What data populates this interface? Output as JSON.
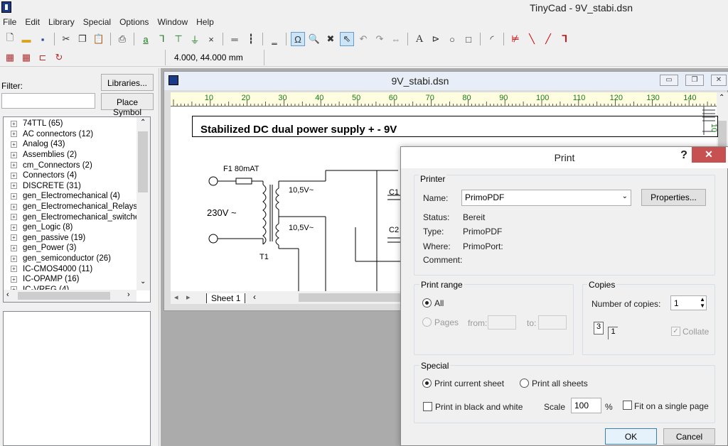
{
  "app": {
    "title": "TinyCad - 9V_stabi.dsn"
  },
  "menu": [
    "File",
    "Edit",
    "Library",
    "Special",
    "Options",
    "Window",
    "Help"
  ],
  "toolbar": {
    "coords": "4.000,  44.000 mm",
    "text_tool": "A",
    "omega_tool": "Ω",
    "close_x": "×"
  },
  "left_panel": {
    "filter_label": "Filter:",
    "filter_value": "",
    "libraries_button": "Libraries...",
    "place_symbol_button": "Place Symbol",
    "libraries": [
      "74TTL (65)",
      "AC connectors (12)",
      "Analog (43)",
      "Assemblies (2)",
      "cm_Connectors (2)",
      "Connectors (4)",
      "DISCRETE (31)",
      "gen_Electromechanical (4)",
      "gen_Electromechanical_Relays (",
      "gen_Electromechanical_switches",
      "gen_Logic (8)",
      "gen_passive (19)",
      "gen_Power (3)",
      "gen_semiconductor (26)",
      "IC-CMOS4000 (11)",
      "IC-OPAMP (16)",
      "IC-VREG (4)"
    ]
  },
  "document": {
    "title": "9V_stabi.dsn",
    "ruler_labels": [
      "10",
      "20",
      "30",
      "40",
      "50",
      "60",
      "70",
      "80",
      "90",
      "100",
      "110",
      "120",
      "130",
      "140"
    ],
    "sheet_tab": "Sheet 1",
    "schematic_title": "Stabilized DC dual power supply + - 9V",
    "labels": {
      "fuse": "F1  80mAT",
      "mains": "230V ~",
      "sec1": "10,5V~",
      "sec2": "10,5V~",
      "transformer": "T1",
      "c1": "C1",
      "c2": "C2",
      "side_ruler": "10"
    }
  },
  "print_dialog": {
    "title": "Print",
    "help": "?",
    "close": "✕",
    "printer_group": "Printer",
    "name_label": "Name:",
    "printer_name": "PrimoPDF",
    "properties_button": "Properties...",
    "status_label": "Status:",
    "status_value": "Bereit",
    "type_label": "Type:",
    "type_value": "PrimoPDF",
    "where_label": "Where:",
    "where_value": "PrimoPort:",
    "comment_label": "Comment:",
    "comment_value": "",
    "range_group": "Print range",
    "all_label": "All",
    "pages_label": "Pages",
    "from_label": "from:",
    "to_label": "to:",
    "copies_group": "Copies",
    "copies_label": "Number of copies:",
    "copies_value": "1",
    "collate_label": "Collate",
    "collate_front": "3",
    "collate_back": "1",
    "special_group": "Special",
    "current_sheet_label": "Print current sheet",
    "all_sheets_label": "Print all sheets",
    "bw_label": "Print in black and white",
    "scale_label": "Scale",
    "scale_value": "100",
    "scale_unit": "%",
    "fit_label": "Fit on a single page",
    "ok_button": "OK",
    "cancel_button": "Cancel"
  }
}
